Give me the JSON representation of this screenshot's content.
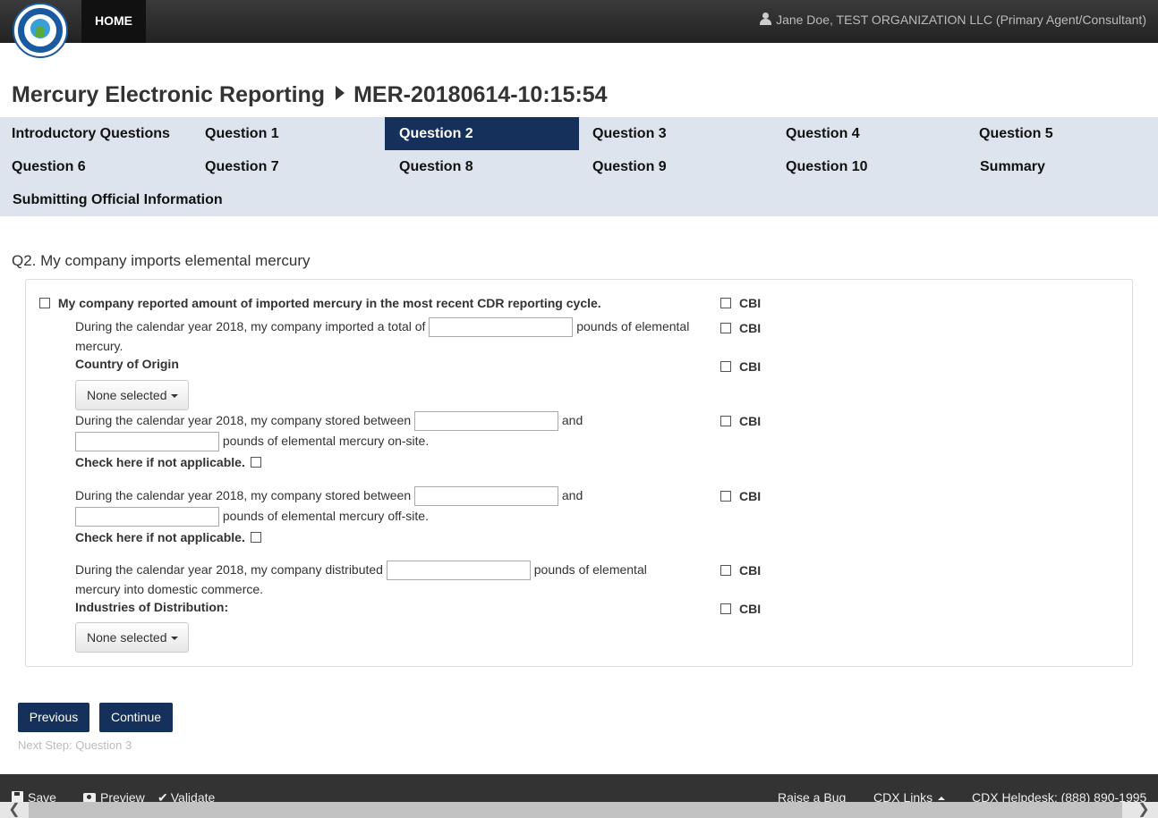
{
  "header": {
    "home_label": "HOME",
    "user_text": "Jane Doe, TEST ORGANIZATION LLC (Primary Agent/Consultant)"
  },
  "page": {
    "title": "Mercury Electronic Reporting",
    "report_id": "MER-20180614-10:15:54"
  },
  "nav": {
    "items": [
      "Introductory Questions",
      "Question 1",
      "Question 2",
      "Question 3",
      "Question 4",
      "Question 5",
      "Question 6",
      "Question 7",
      "Question 8",
      "Question 9",
      "Question 10",
      "Summary",
      "Submitting Official Information"
    ],
    "active": "Question 2"
  },
  "question": {
    "title": "Q2. My company imports elemental mercury",
    "cdr_checkbox_label": "My company reported amount of imported mercury in the most recent CDR reporting cycle.",
    "cbi_label": "CBI",
    "imported_pre": "During the calendar year 2018, my company imported a total of",
    "imported_post": "pounds of elemental",
    "imported_cont": "mercury.",
    "imported_value": "",
    "country_label": "Country of Origin",
    "country_dropdown": "None selected",
    "onsite_pre": "During the calendar year 2018, my company stored between",
    "onsite_and": "and",
    "onsite_post": "pounds of elemental mercury on-site.",
    "onsite_min": "",
    "onsite_max": "",
    "not_applicable": "Check here if not applicable.",
    "offsite_pre": "During the calendar year 2018, my company stored between",
    "offsite_and": "and",
    "offsite_post": "pounds of elemental mercury off-site.",
    "offsite_min": "",
    "offsite_max": "",
    "distributed_pre": "During the calendar year 2018, my company distributed",
    "distributed_post": "pounds of elemental",
    "distributed_cont": "mercury into domestic commerce.",
    "distributed_value": "",
    "industries_label": "Industries of Distribution:",
    "industries_dropdown": "None selected"
  },
  "actions": {
    "previous": "Previous",
    "continue": "Continue",
    "next_step": "Next Step: Question 3"
  },
  "footer": {
    "save": "Save",
    "preview": "Preview",
    "validate": "Validate",
    "raise_bug": "Raise a Bug",
    "cdx_links": "CDX Links",
    "helpdesk": "CDX Helpdesk: (888) 890-1995"
  }
}
